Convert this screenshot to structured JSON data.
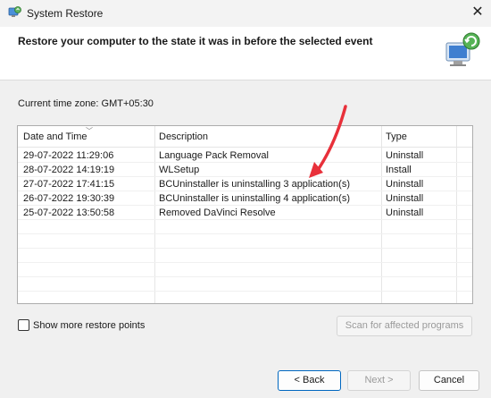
{
  "window": {
    "title": "System Restore",
    "close_glyph": "✕",
    "icon": "system-restore-icon"
  },
  "header": {
    "title": "Restore your computer to the state it was in before the selected event",
    "icon": "restore-computer-icon"
  },
  "timezone_label": "Current time zone: GMT+05:30",
  "table": {
    "columns": [
      "Date and Time",
      "Description",
      "Type"
    ],
    "rows": [
      {
        "date": "29-07-2022 11:29:06",
        "description": "Language Pack Removal",
        "type": "Uninstall"
      },
      {
        "date": "28-07-2022 14:19:19",
        "description": "WLSetup",
        "type": "Install"
      },
      {
        "date": "27-07-2022 17:41:15",
        "description": "BCUninstaller is uninstalling 3 application(s)",
        "type": "Uninstall"
      },
      {
        "date": "26-07-2022 19:30:39",
        "description": "BCUninstaller is uninstalling 4 application(s)",
        "type": "Uninstall"
      },
      {
        "date": "25-07-2022 13:50:58",
        "description": "Removed DaVinci Resolve",
        "type": "Uninstall"
      }
    ]
  },
  "show_more_label": "Show more restore points",
  "scan_button_label": "Scan for affected programs",
  "buttons": {
    "back": "< Back",
    "next": "Next >",
    "cancel": "Cancel"
  },
  "colors": {
    "annotation_arrow": "#e8303a",
    "focus_border": "#0067c0"
  }
}
